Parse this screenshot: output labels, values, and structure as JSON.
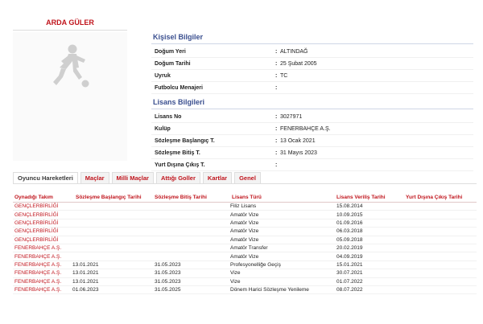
{
  "player": {
    "name": "ARDA GÜLER"
  },
  "personal": {
    "title": "Kişisel Bilgiler",
    "rows": [
      {
        "label": "Doğum Yeri",
        "value": "ALTINDAĞ"
      },
      {
        "label": "Doğum Tarihi",
        "value": "25 Şubat 2005"
      },
      {
        "label": "Uyruk",
        "value": "TC"
      },
      {
        "label": "Futbolcu Menajeri",
        "value": ""
      }
    ]
  },
  "license": {
    "title": "Lisans Bilgileri",
    "rows": [
      {
        "label": "Lisans No",
        "value": "3027971"
      },
      {
        "label": "Kulüp",
        "value": "FENERBAHÇE A.Ş."
      },
      {
        "label": "Sözleşme Başlangıç T.",
        "value": "13 Ocak 2021"
      },
      {
        "label": "Sözleşme Bitiş T.",
        "value": "31 Mayıs 2023"
      },
      {
        "label": "Yurt Dışına Çıkış T.",
        "value": ""
      }
    ]
  },
  "kv_separator": ":",
  "tabs": [
    {
      "label": "Oyuncu Hareketleri",
      "active": true
    },
    {
      "label": "Maçlar",
      "active": false
    },
    {
      "label": "Milli Maçlar",
      "active": false
    },
    {
      "label": "Attığı Goller",
      "active": false
    },
    {
      "label": "Kartlar",
      "active": false
    },
    {
      "label": "Genel",
      "active": false
    }
  ],
  "table": {
    "headers": [
      "Oynadığı Takım",
      "Sözleşme Başlangıç Tarihi",
      "Sözleşme Bitiş Tarihi",
      "Lisans Türü",
      "Lisans Veriliş Tarihi",
      "Yurt Dışına Çıkış Tarihi"
    ],
    "rows": [
      [
        "GENÇLERBİRLİĞİ",
        "",
        "",
        "Filiz Lisans",
        "15.08.2014",
        ""
      ],
      [
        "GENÇLERBİRLİĞİ",
        "",
        "",
        "Amatör Vize",
        "10.09.2015",
        ""
      ],
      [
        "GENÇLERBİRLİĞİ",
        "",
        "",
        "Amatör Vize",
        "01.09.2016",
        ""
      ],
      [
        "GENÇLERBİRLİĞİ",
        "",
        "",
        "Amatör Vize",
        "06.03.2018",
        ""
      ],
      [
        "GENÇLERBİRLİĞİ",
        "",
        "",
        "Amatör Vize",
        "05.09.2018",
        ""
      ],
      [
        "FENERBAHÇE A.Ş.",
        "",
        "",
        "Amatör Transfer",
        "20.02.2019",
        ""
      ],
      [
        "FENERBAHÇE A.Ş.",
        "",
        "",
        "Amatör Vize",
        "04.09.2019",
        ""
      ],
      [
        "FENERBAHÇE A.Ş.",
        "13.01.2021",
        "31.05.2023",
        "Profesyonelliğe Geçiş",
        "15.01.2021",
        ""
      ],
      [
        "FENERBAHÇE A.Ş.",
        "13.01.2021",
        "31.05.2023",
        "Vize",
        "30.07.2021",
        ""
      ],
      [
        "FENERBAHÇE A.Ş.",
        "13.01.2021",
        "31.05.2023",
        "Vize",
        "01.07.2022",
        ""
      ],
      [
        "FENERBAHÇE A.Ş.",
        "01.06.2023",
        "31.05.2025",
        "Dönem Harici Sözleşme Yenileme",
        "08.07.2022",
        ""
      ]
    ]
  }
}
